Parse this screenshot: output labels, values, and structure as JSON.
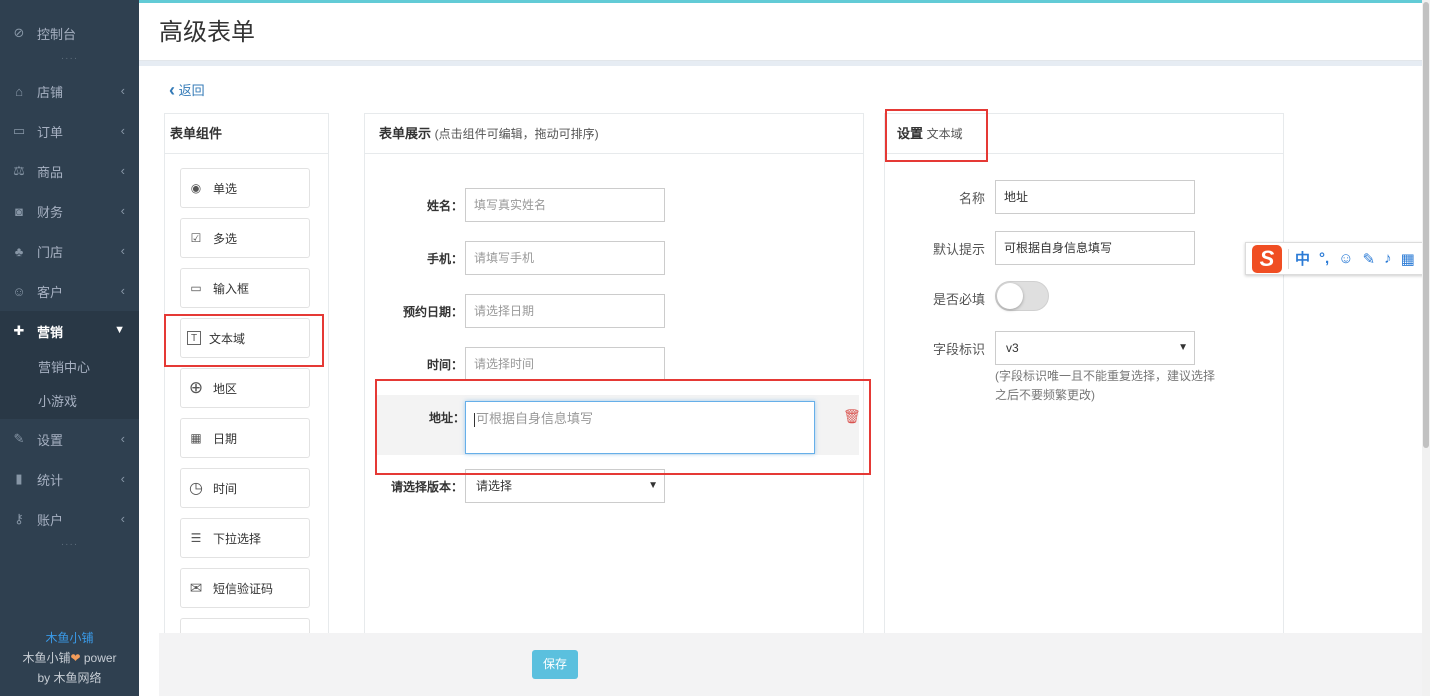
{
  "sidebar": {
    "items": [
      {
        "label": "控制台",
        "icon": "dashboard-icon",
        "glyph": "⊘"
      },
      {
        "label": "店铺",
        "icon": "basket-icon",
        "glyph": "⌂"
      },
      {
        "label": "订单",
        "icon": "credit-card-icon",
        "glyph": "▭"
      },
      {
        "label": "商品",
        "icon": "balance-scale-icon",
        "glyph": "⚖"
      },
      {
        "label": "财务",
        "icon": "money-icon",
        "glyph": "◙"
      },
      {
        "label": "门店",
        "icon": "sitemap-icon",
        "glyph": "♣"
      },
      {
        "label": "客户",
        "icon": "users-icon",
        "glyph": "☺"
      },
      {
        "label": "营销",
        "icon": "gift-icon",
        "glyph": "✚"
      },
      {
        "label": "设置",
        "icon": "wrench-icon",
        "glyph": "✎"
      },
      {
        "label": "统计",
        "icon": "signal-icon",
        "glyph": "▮"
      },
      {
        "label": "账户",
        "icon": "key-icon",
        "glyph": "⚷"
      }
    ],
    "subitems": [
      "营销中心",
      "小游戏"
    ],
    "dots": "····",
    "footer": {
      "brand": "木鱼小铺",
      "power_prefix": "木鱼小铺",
      "heart": "❤",
      "power_suffix": " power",
      "by": "by 木鱼网络"
    }
  },
  "header": {
    "title": "高级表单"
  },
  "back": {
    "label": "返回",
    "glyph": "‹"
  },
  "components_panel": {
    "title": "表单组件",
    "items": [
      {
        "label": "单选",
        "icon": "radio-icon",
        "glyph": "◉"
      },
      {
        "label": "多选",
        "icon": "checkbox-icon",
        "glyph": "☑"
      },
      {
        "label": "输入框",
        "icon": "input-box-icon",
        "glyph": "▭"
      },
      {
        "label": "文本域",
        "icon": "textarea-icon",
        "glyph": "T"
      },
      {
        "label": "地区",
        "icon": "globe-icon",
        "glyph": "⊕"
      },
      {
        "label": "日期",
        "icon": "calendar-icon",
        "glyph": "▦"
      },
      {
        "label": "时间",
        "icon": "stopwatch-icon",
        "glyph": "◷"
      },
      {
        "label": "下拉选择",
        "icon": "server-icon",
        "glyph": "☰"
      },
      {
        "label": "短信验证码",
        "icon": "envelope-icon",
        "glyph": "✉"
      }
    ]
  },
  "display_panel": {
    "title": "表单展示",
    "subtitle": "(点击组件可编辑，拖动可排序)",
    "fields": [
      {
        "label": "姓名：",
        "placeholder": "填写真实姓名"
      },
      {
        "label": "手机：",
        "placeholder": "请填写手机"
      },
      {
        "label": "预约日期：",
        "placeholder": "请选择日期"
      },
      {
        "label": "时间：",
        "placeholder": "请选择时间"
      }
    ],
    "textarea": {
      "label": "地址：",
      "placeholder": "可根据自身信息填写"
    },
    "select": {
      "label": "请选择版本：",
      "value": "请选择"
    },
    "delete_glyph": "🗑"
  },
  "settings_panel": {
    "title": "设置",
    "subtitle": "文本域",
    "name": {
      "label": "名称",
      "value": "地址"
    },
    "default_hint": {
      "label": "默认提示",
      "value": "可根据自身信息填写"
    },
    "required": {
      "label": "是否必填",
      "on": false
    },
    "field_id": {
      "label": "字段标识",
      "value": "v3"
    },
    "field_id_hint": "(字段标识唯一且不能重复选择，建议选择之后不要频繁更改)"
  },
  "footer": {
    "save_label": "保存"
  },
  "ime": {
    "logo": "S",
    "lang": "中",
    "punct": "°,",
    "emoji": "☺",
    "pen": "✎",
    "mic": "♪",
    "grid": "▦"
  },
  "colors": {
    "sidebar_bg": "#2f4050",
    "accent": "#62cbd6",
    "save_btn": "#5bc0de",
    "highlight_border": "#e53935",
    "link": "#337ab7"
  }
}
